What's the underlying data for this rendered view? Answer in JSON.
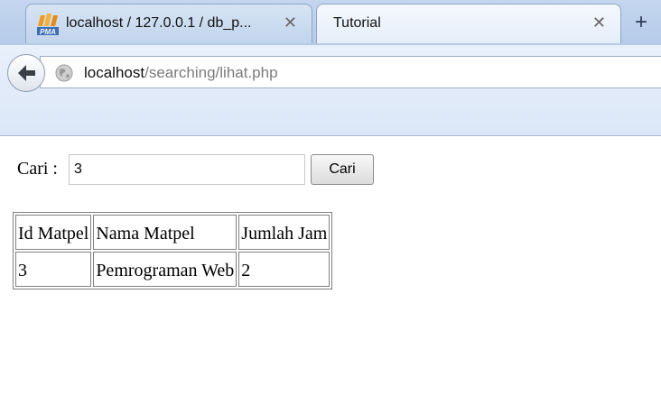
{
  "browser": {
    "tabs": [
      {
        "title": "localhost / 127.0.0.1 / db_p...",
        "favicon": "phpmyadmin-icon",
        "close": "✕"
      },
      {
        "title": "Tutorial",
        "close": "✕"
      }
    ],
    "new_tab": "+",
    "url": {
      "host": "localhost",
      "path": "/searching/lihat.php"
    }
  },
  "page": {
    "search": {
      "label": "Cari :",
      "value": "3",
      "button": "Cari"
    },
    "table": {
      "headers": [
        "Id Matpel",
        "Nama Matpel",
        "Jumlah Jam"
      ],
      "rows": [
        [
          "3",
          "Pemrograman Web",
          "2"
        ]
      ]
    }
  }
}
